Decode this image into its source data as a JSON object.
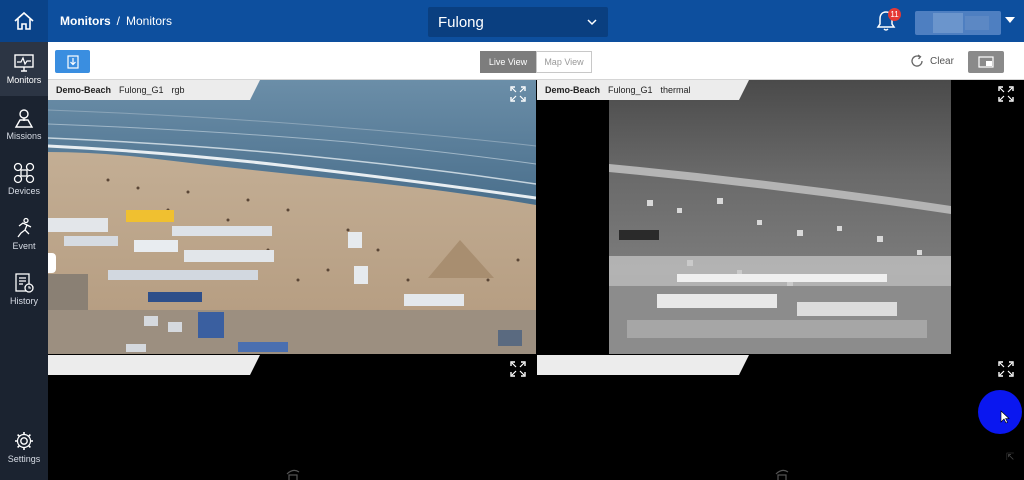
{
  "header": {
    "breadcrumb_root": "Monitors",
    "breadcrumb_separator": "/",
    "breadcrumb_current": "Monitors",
    "site_selector": "Fulong",
    "notification_count": "11"
  },
  "sidebar": {
    "items": [
      {
        "label": "Monitors",
        "icon": "monitor-icon",
        "active": true
      },
      {
        "label": "Missions",
        "icon": "map-pin-icon",
        "active": false
      },
      {
        "label": "Devices",
        "icon": "drone-icon",
        "active": false
      },
      {
        "label": "Event",
        "icon": "runner-icon",
        "active": false
      },
      {
        "label": "History",
        "icon": "history-icon",
        "active": false
      },
      {
        "label": "Settings",
        "icon": "gear-icon",
        "active": false
      }
    ]
  },
  "toolbar": {
    "tabs": [
      {
        "label": "Live View",
        "active": true
      },
      {
        "label": "Map View",
        "active": false
      }
    ],
    "clear_label": "Clear"
  },
  "cells": [
    {
      "site": "Demo-Beach",
      "device": "Fulong_G1",
      "stream": "rgb"
    },
    {
      "site": "Demo-Beach",
      "device": "Fulong_G1",
      "stream": "thermal"
    },
    {
      "site": "",
      "device": "",
      "stream": ""
    },
    {
      "site": "",
      "device": "",
      "stream": ""
    }
  ],
  "colors": {
    "header": "#0d4f9e",
    "sidebar": "#1b2330",
    "accent": "#3a8ee0",
    "badge": "#e53935"
  }
}
